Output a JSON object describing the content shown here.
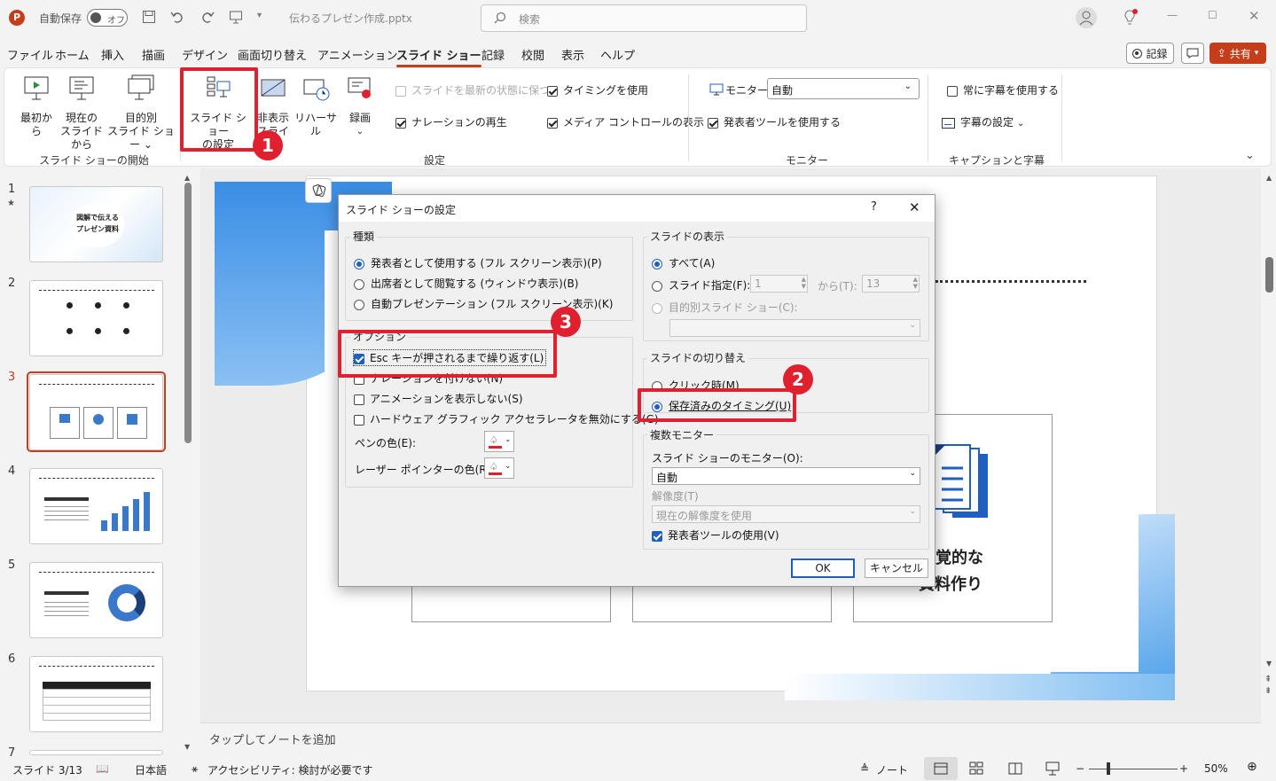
{
  "titlebar": {
    "autosave_label": "自動保存",
    "autosave_state": "オフ",
    "filename": "伝わるプレゼン作成.pptx",
    "search_placeholder": "検索"
  },
  "menu": [
    "ファイル",
    "ホーム",
    "挿入",
    "描画",
    "デザイン",
    "画面切り替え",
    "アニメーション",
    "スライド ショー",
    "記録",
    "校閲",
    "表示",
    "ヘルプ"
  ],
  "menu_active": "スライド ショー",
  "header_buttons": {
    "record": "記録",
    "share": "共有"
  },
  "ribbon": {
    "start": {
      "from_beginning": "最初から",
      "from_current_1": "現在の",
      "from_current_2": "スライドから",
      "custom_1": "目的別",
      "custom_2": "スライド ショー",
      "group": "スライド ショーの開始"
    },
    "setup": {
      "setup_1": "スライド ショー",
      "setup_2": "の設定",
      "hide_1": "非表示",
      "hide_2": "スライド",
      "rehearse": "リハーサル",
      "record": "録画",
      "keep_updated": "スライドを最新の状態に保つ",
      "play_narration": "ナレーションの再生",
      "use_timings": "タイミングを使用",
      "show_media": "メディア コントロールの表示",
      "group": "設定"
    },
    "monitor": {
      "monitor_label": "モニター:",
      "monitor_value": "自動",
      "presenter_view": "発表者ツールを使用する",
      "group": "モニター"
    },
    "captions": {
      "always_subtitles": "常に字幕を使用する",
      "subtitle_settings": "字幕の設定",
      "group": "キャプションと字幕"
    }
  },
  "thumbnails": [
    {
      "num": "1",
      "title": "図解で伝える\nプレゼン資料"
    },
    {
      "num": "2",
      "title": ""
    },
    {
      "num": "3",
      "title": ""
    },
    {
      "num": "4",
      "title": ""
    },
    {
      "num": "5",
      "title": ""
    },
    {
      "num": "6",
      "title": ""
    },
    {
      "num": "7",
      "title": ""
    }
  ],
  "slide_fragments": {
    "card3_line1": "覚的な",
    "card3_line2": "資料作り"
  },
  "dialog": {
    "title": "スライド ショーの設定",
    "help": "?",
    "type_legend": "種類",
    "type_options": [
      "発表者として使用する (フル スクリーン表示)(P)",
      "出席者として閲覧する (ウィンドウ表示)(B)",
      "自動プレゼンテーション (フル スクリーン表示)(K)"
    ],
    "options_legend": "オプション",
    "options": [
      "Esc キーが押されるまで繰り返す(L)",
      "ナレーションを付けない(N)",
      "アニメーションを表示しない(S)",
      "ハードウェア グラフィック アクセラレータを無効にする(G)"
    ],
    "pen_color": "ペンの色(E):",
    "laser_color": "レーザー ポインターの色(R):",
    "show_slides_legend": "スライドの表示",
    "all": "すべて(A)",
    "from_label": "スライド指定(F):",
    "from_value": "1",
    "to_label": "から(T):",
    "to_value": "13",
    "custom_show": "目的別スライド ショー(C):",
    "advance_legend": "スライドの切り替え",
    "manual": "クリック時(M)",
    "use_timings": "保存済みのタイミング(U)",
    "multi_monitor_legend": "複数モニター",
    "slideshow_monitor": "スライド ショーのモニター(O):",
    "monitor_value": "自動",
    "resolution": "解像度(T)",
    "resolution_value": "現在の解像度を使用",
    "presenter_view": "発表者ツールの使用(V)",
    "ok": "OK",
    "cancel": "キャンセル"
  },
  "badges": [
    "1",
    "2",
    "3"
  ],
  "notes_placeholder": "タップしてノートを追加",
  "status": {
    "slide": "スライド 3/13",
    "language": "日本語",
    "accessibility": "アクセシビリティ: 検討が必要です",
    "notes": "ノート",
    "zoom": "50%"
  }
}
